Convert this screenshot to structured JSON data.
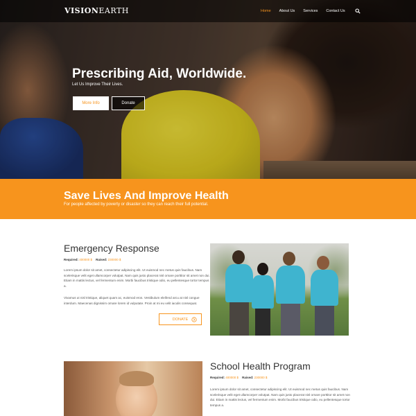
{
  "brand": {
    "part1": "VISION",
    "part2": "EARTH"
  },
  "nav": {
    "items": [
      "Home",
      "About Us",
      "Services",
      "Contact Us"
    ],
    "active_color": "#f7941d",
    "search_icon": "search-icon"
  },
  "hero": {
    "title": "Prescribing Aid, Worldwide.",
    "subtitle": "Let Us Improve Their Lives.",
    "btn_more": "More Info",
    "btn_donate": "Donate"
  },
  "band": {
    "title": "Save Lives And Improve Health",
    "subtitle": "For people affected by poverty or disaster so they can reach their full potential.",
    "color": "#f7941d"
  },
  "emergency": {
    "title": "Emergency Response",
    "required_label": "Required:",
    "required_value": "400000 $",
    "raised_label": "Raised:",
    "raised_value": "230000 $",
    "para1": "Lorem ipsum dolor sit amet, consectetur adipiscing elit. Ut euismod nec metus quis faucibus. Nam scelerisque velit eget ullamcorper volutpat. Nam quis justo placerat nisl ornare porttitor sit amet non dui. Etiam in mattis lectus, vel fermentum enim. Morbi faucibus tristique odio, eu pellentesque tortor tempus a.",
    "para2": "Vivamus ut nisl tristique, aliquet quam ac, euismod eros. Vestibulum eleifend arcu at nisl congue interdum. Maecenas dignissim ornare lorem id vulputate. Proin at mi eu velit iaculis consequat.",
    "donate_label": "DONATE"
  },
  "school": {
    "title": "School Health Program",
    "required_label": "Required:",
    "required_value": "400000 $",
    "raised_label": "Raised:",
    "raised_value": "230000 $",
    "para1": "Lorem ipsum dolor sit amet, consectetur adipiscing elit. Ut euismod nec metus quis faucibus. Nam scelerisque velit eget ullamcorper volutpat. Nam quis justo placerat nisl ornare porttitor sit amet non dui. Etiam in mattis lectus, vel fermentum enim. Morbi faucibus tristique odio, eu pellentesque tortor tempus a."
  }
}
